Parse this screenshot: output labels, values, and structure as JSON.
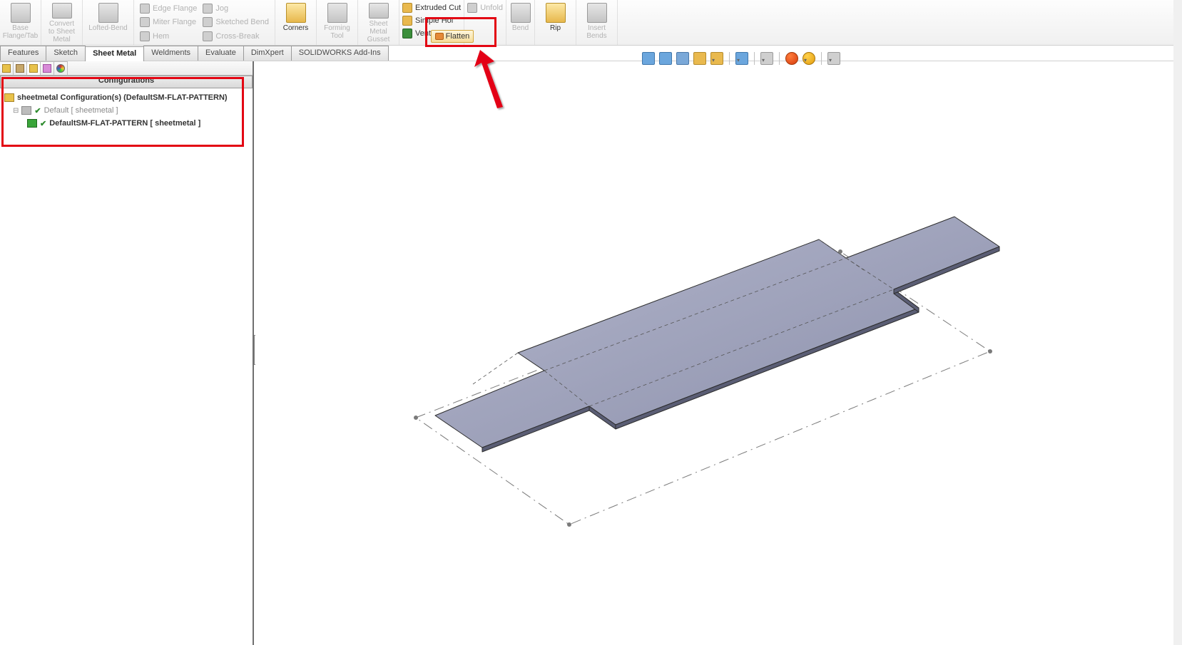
{
  "ribbon": {
    "base_flange": "Base\nFlange/Tab",
    "convert": "Convert\nto Sheet\nMetal",
    "lofted_bend": "Lofted-Bend",
    "edge_flange": "Edge Flange",
    "miter_flange": "Miter Flange",
    "hem": "Hem",
    "jog": "Jog",
    "sketched_bend": "Sketched Bend",
    "cross_break": "Cross-Break",
    "corners": "Corners",
    "forming_tool": "Forming\nTool",
    "sheet_metal_gusset": "Sheet\nMetal\nGusset",
    "extruded_cut": "Extruded Cut",
    "simple_hole": "Simple Hol",
    "vent": "Vent",
    "unfold": "Unfold",
    "no_bends": "Bend",
    "rip": "Rip",
    "insert_bends": "Insert\nBends",
    "flatten": "Flatten"
  },
  "tabs": {
    "features": "Features",
    "sketch": "Sketch",
    "sheet_metal": "Sheet Metal",
    "weldments": "Weldments",
    "evaluate": "Evaluate",
    "dimxpert": "DimXpert",
    "addins": "SOLIDWORKS Add-Ins"
  },
  "config_panel": {
    "title": "Configurations",
    "root": "sheetmetal Configuration(s)  (DefaultSM-FLAT-PATTERN)",
    "row1": "Default [ sheetmetal ]",
    "row2": "DefaultSM-FLAT-PATTERN [ sheetmetal ]"
  },
  "hud_icons": [
    "zoom-fit-icon",
    "zoom-area-icon",
    "previous-view-icon",
    "section-view-icon",
    "view-orientation-icon",
    "display-style-icon",
    "hide-show-icon",
    "edit-appearance-icon",
    "apply-scene-icon",
    "view-settings-icon"
  ],
  "pane_tab_icons": [
    "feature-manager-icon",
    "property-manager-icon",
    "configuration-manager-icon",
    "dimxpert-manager-icon",
    "display-manager-icon",
    "appearances-manager-icon"
  ]
}
